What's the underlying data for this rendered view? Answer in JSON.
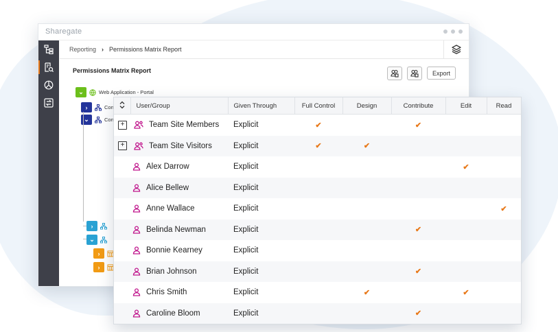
{
  "app": {
    "logo": "Sharegate"
  },
  "breadcrumb": {
    "parent": "Reporting",
    "separator": "›",
    "current": "Permissions Matrix Report"
  },
  "report": {
    "title": "Permissions Matrix Report",
    "export_label": "Export"
  },
  "tree": {
    "root_label": "Web Application - Portal",
    "child1_label": "Con",
    "child2_label": "Con"
  },
  "grid": {
    "columns": [
      "User/Group",
      "Given Through",
      "Full Control",
      "Design",
      "Contribute",
      "Edit",
      "Read"
    ],
    "rows": [
      {
        "name": "Team Site Members",
        "type": "group",
        "given": "Explicit",
        "full_control": "✔",
        "design": "",
        "contribute": "✔",
        "edit": "",
        "read": ""
      },
      {
        "name": "Team Site Visitors",
        "type": "group",
        "given": "Explicit",
        "full_control": "✔",
        "design": "✔",
        "contribute": "",
        "edit": "",
        "read": ""
      },
      {
        "name": "Alex Darrow",
        "type": "user",
        "given": "Explicit",
        "full_control": "",
        "design": "",
        "contribute": "",
        "edit": "✔",
        "read": ""
      },
      {
        "name": "Alice Bellew",
        "type": "user",
        "given": "Explicit",
        "full_control": "",
        "design": "",
        "contribute": "",
        "edit": "",
        "read": ""
      },
      {
        "name": "Anne Wallace",
        "type": "user",
        "given": "Explicit",
        "full_control": "",
        "design": "",
        "contribute": "",
        "edit": "",
        "read": "✔"
      },
      {
        "name": "Belinda Newman",
        "type": "user",
        "given": "Explicit",
        "full_control": "",
        "design": "",
        "contribute": "✔",
        "edit": "",
        "read": ""
      },
      {
        "name": "Bonnie Kearney",
        "type": "user",
        "given": "Explicit",
        "full_control": "",
        "design": "",
        "contribute": "",
        "edit": "",
        "read": ""
      },
      {
        "name": "Brian Johnson",
        "type": "user",
        "given": "Explicit",
        "full_control": "",
        "design": "",
        "contribute": "✔",
        "edit": "",
        "read": ""
      },
      {
        "name": "Chris Smith",
        "type": "user",
        "given": "Explicit",
        "full_control": "",
        "design": "✔",
        "contribute": "",
        "edit": "✔",
        "read": ""
      },
      {
        "name": "Caroline Bloom",
        "type": "user",
        "given": "Explicit",
        "full_control": "",
        "design": "",
        "contribute": "✔",
        "edit": "",
        "read": ""
      }
    ]
  },
  "colors": {
    "accent": "#e8791a",
    "user_icon": "#c0158c",
    "sidebar": "#3e4049"
  }
}
